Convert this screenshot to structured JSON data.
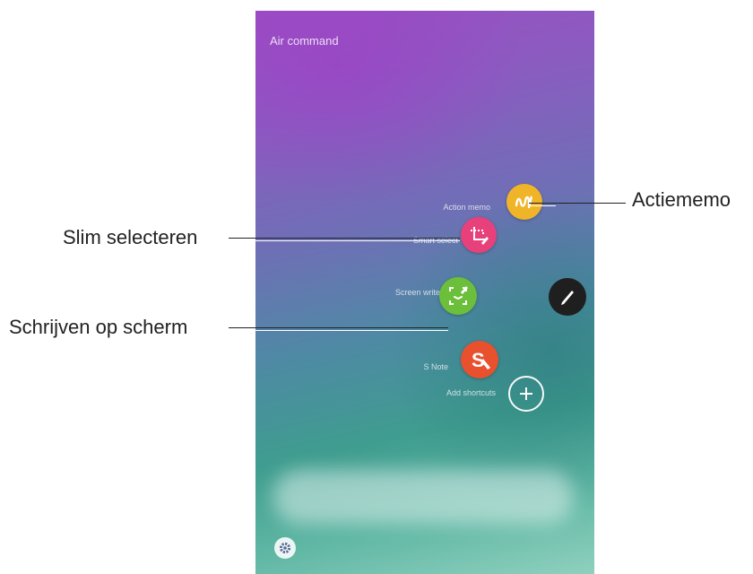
{
  "screen": {
    "title": "Air command"
  },
  "commands": [
    {
      "label": "Action memo",
      "icon": "action-memo-icon",
      "color": "#f0b429"
    },
    {
      "label": "Smart select",
      "icon": "smart-select-icon",
      "color": "#e8407a"
    },
    {
      "label": "Screen write",
      "icon": "screen-write-icon",
      "color": "#6cbf3a"
    },
    {
      "label": "S Note",
      "icon": "s-note-icon",
      "color": "#e8502e"
    },
    {
      "label": "Add shortcuts",
      "icon": "plus-icon",
      "color": "#ffffff"
    }
  ],
  "pen_button": {
    "icon": "pen-icon",
    "color": "#1f1f1f"
  },
  "settings_button": {
    "icon": "gear-icon"
  },
  "callouts": {
    "action_memo": "Actiememo",
    "smart_select": "Slim selecteren",
    "screen_write": "Schrijven op scherm"
  }
}
